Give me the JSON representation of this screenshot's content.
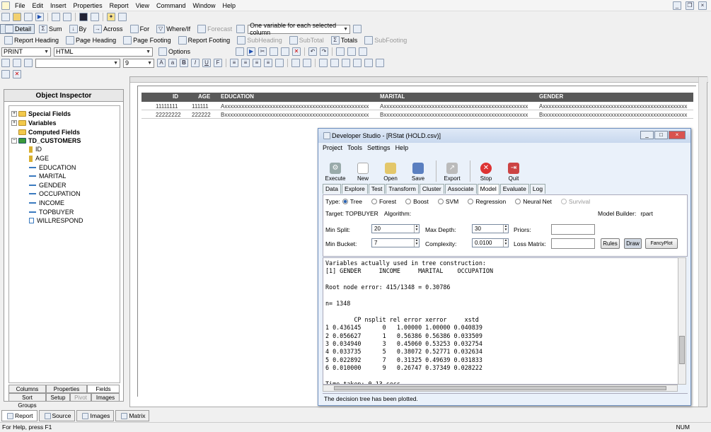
{
  "menu": [
    "File",
    "Edit",
    "Insert",
    "Properties",
    "Report",
    "View",
    "Command",
    "Window",
    "Help"
  ],
  "toolbar1": {
    "detail": "Detail",
    "sum": "Sum",
    "by": "By",
    "across": "Across",
    "for": "For",
    "where_if": "Where/If",
    "forecast": "Forecast",
    "variable_combo": "One variable for each selected column"
  },
  "toolbar2": {
    "report_heading": "Report Heading",
    "page_heading": "Page Heading",
    "page_footing": "Page Footing",
    "report_footing": "Report Footing",
    "subheading": "SubHeading",
    "subtotal": "SubTotal",
    "totals": "Totals",
    "subfooting": "SubFooting"
  },
  "toolbar3": {
    "print_combo": "PRINT",
    "format_combo": "HTML",
    "options": "Options"
  },
  "toolbar4": {
    "font_size": "9"
  },
  "inspector": {
    "title": "Object Inspector",
    "nodes": [
      {
        "label": "Special Fields"
      },
      {
        "label": "Variables"
      },
      {
        "label": "Computed Fields"
      },
      {
        "label": "TD_CUSTOMERS"
      }
    ],
    "fields": [
      "ID",
      "AGE",
      "EDUCATION",
      "MARITAL",
      "GENDER",
      "OCCUPATION",
      "INCOME",
      "TOPBUYER",
      "WILLRESPOND"
    ],
    "tabs_row1": [
      "Columns",
      "Properties",
      "Fields"
    ],
    "tabs_row2": [
      "Sort Groups",
      "Setup",
      "Pivot",
      "Images"
    ]
  },
  "report": {
    "headers": [
      "ID",
      "AGE",
      "EDUCATION",
      "MARITAL",
      "GENDER"
    ],
    "rows": [
      [
        "11111111",
        "111111",
        "Axxxxxxxxxxxxxxxxxxxxxxxxxxxxxxxxxxxxxxxxxxxxxxxxxxx",
        "Axxxxxxxxxxxxxxxxxxxxxxxxxxxxxxxxxxxxxxxxxxxxxxxxxxx",
        "Axxxxxxxxxxxxxxxxxxxxxxxxxxxxxxxxxxxxxxxxxxxxxxxxxxx"
      ],
      [
        "22222222",
        "222222",
        "Bxxxxxxxxxxxxxxxxxxxxxxxxxxxxxxxxxxxxxxxxxxxxxxxxxxx",
        "Bxxxxxxxxxxxxxxxxxxxxxxxxxxxxxxxxxxxxxxxxxxxxxxxxxxx",
        "Bxxxxxxxxxxxxxxxxxxxxxxxxxxxxxxxxxxxxxxxxxxxxxxxxxxx"
      ]
    ]
  },
  "dev": {
    "title": "Developer Studio - [RStat (HOLD.csv)]",
    "menu": [
      "Project",
      "Tools",
      "Settings",
      "Help"
    ],
    "tools": [
      "Execute",
      "New",
      "Open",
      "Save",
      "Export",
      "Stop",
      "Quit"
    ],
    "tabs": [
      "Data",
      "Explore",
      "Test",
      "Transform",
      "Cluster",
      "Associate",
      "Model",
      "Evaluate",
      "Log"
    ],
    "type_label": "Type:",
    "types": [
      "Tree",
      "Forest",
      "Boost",
      "SVM",
      "Regression",
      "Neural Net",
      "Survival"
    ],
    "target": "Target: TOPBUYER",
    "algorithm": "Algorithm:",
    "builder": "Model Builder:",
    "builder_value": "rpart",
    "min_split_label": "Min Split:",
    "min_split": "20",
    "max_depth_label": "Max Depth:",
    "max_depth": "30",
    "priors_label": "Priors:",
    "min_bucket_label": "Min Bucket:",
    "min_bucket": "7",
    "complexity_label": "Complexity:",
    "complexity": "0.0100",
    "loss_label": "Loss Matrix:",
    "rules": "Rules",
    "draw": "Draw",
    "fancy": "FancyPlot",
    "console": "Variables actually used in tree construction:\n[1] GENDER     INCOME     MARITAL    OCCUPATION\n\nRoot node error: 415/1348 = 0.30786\n\nn= 1348\n\n        CP nsplit rel error xerror     xstd\n1 0.436145      0   1.00000 1.00000 0.040839\n2 0.056627      1   0.56386 0.56386 0.033509\n3 0.034940      3   0.45060 0.53253 0.032754\n4 0.033735      5   0.38072 0.52771 0.032634\n5 0.022892      7   0.31325 0.49639 0.031833\n6 0.010000      9   0.26747 0.37349 0.028222\n\nTime taken: 0.13 secs",
    "status": "The decision tree has been plotted."
  },
  "bottom_tabs": [
    "Report",
    "Source",
    "Images",
    "Matrix"
  ],
  "status": {
    "left": "For Help, press F1",
    "right": "NUM"
  }
}
